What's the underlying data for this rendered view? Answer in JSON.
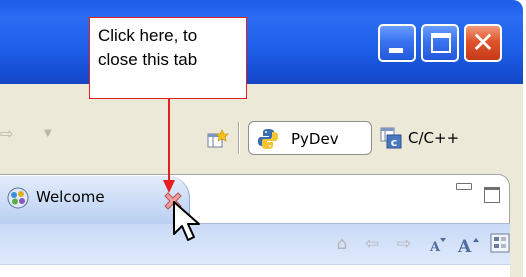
{
  "window": {
    "controls": [
      "minimize-icon",
      "maximize-icon",
      "close-icon"
    ],
    "title_gradient": "#1f60ea"
  },
  "toolbar": {
    "perspectives": {
      "pydev_label": "PyDev",
      "cpp_label": "C/C++"
    }
  },
  "editor": {
    "tab": {
      "label": "Welcome",
      "close_icon": "close-icon"
    },
    "view_controls": [
      "minimize-icon",
      "maximize-icon"
    ],
    "subtoolbar_icons": [
      "home-icon",
      "back-icon",
      "forward-icon",
      "decrease-font-icon",
      "increase-font-icon",
      "layout-icon"
    ]
  },
  "callout": {
    "line1": "Click here, to",
    "line2": "close this tab",
    "border_color": "#e61e1e"
  }
}
